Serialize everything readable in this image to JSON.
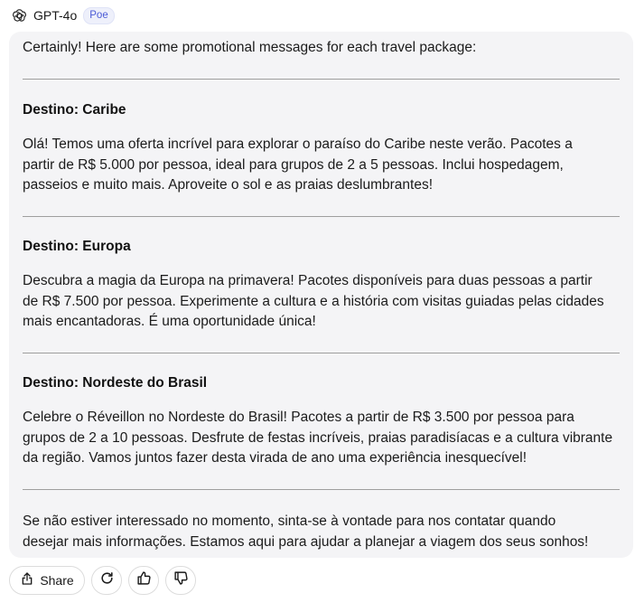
{
  "header": {
    "bot_name": "GPT-4o",
    "badge": "Poe",
    "avatar_icon": "openai-logo-icon"
  },
  "message": {
    "intro": "Certainly! Here are some promotional messages for each travel package:",
    "sections": [
      {
        "heading": "Destino: Caribe",
        "lines": [
          "Olá! Temos uma oferta incrível para explorar o paraíso do Caribe neste verão. Pacotes a",
          "partir de R$ 5.000 por pessoa, ideal para grupos de 2 a 5 pessoas. Inclui hospedagem,",
          "passeios e muito mais. Aproveite o sol e as praias deslumbrantes!"
        ]
      },
      {
        "heading": "Destino: Europa",
        "lines": [
          "Descubra a magia da Europa na primavera! Pacotes disponíveis para duas pessoas a partir",
          "de R$ 7.500 por pessoa. Experimente a cultura e a história com visitas guiadas pelas cidades",
          "mais encantadoras. É uma oportunidade única!"
        ]
      },
      {
        "heading": "Destino: Nordeste do Brasil",
        "lines": [
          "Celebre o Réveillon no Nordeste do Brasil! Pacotes a partir de R$ 3.500 por pessoa para",
          "grupos de 2 a 10 pessoas. Desfrute de festas incríveis, praias paradisíacas e a cultura vibrante",
          "da região. Vamos juntos fazer desta virada de ano uma experiência inesquecível!"
        ]
      }
    ],
    "closing": [
      "Se não estiver interessado no momento, sinta-se à vontade para nos contatar quando",
      "desejar mais informações. Estamos aqui para ajudar a planejar a viagem dos seus sonhos!"
    ]
  },
  "actions": {
    "share_label": "Share",
    "share_icon": "share-icon",
    "retry_icon": "retry-icon",
    "like_icon": "thumbs-up-icon",
    "dislike_icon": "thumbs-down-icon"
  }
}
